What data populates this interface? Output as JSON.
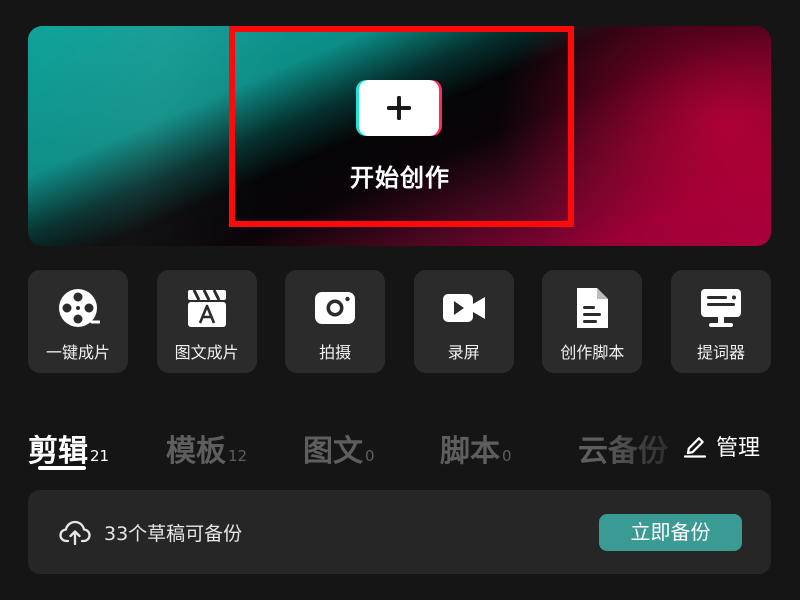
{
  "hero": {
    "create_label": "开始创作"
  },
  "tools": [
    {
      "label": "一键成片",
      "icon": "film-reel-icon"
    },
    {
      "label": "图文成片",
      "icon": "clapperboard-text-icon"
    },
    {
      "label": "拍摄",
      "icon": "camera-icon"
    },
    {
      "label": "录屏",
      "icon": "screen-record-icon"
    },
    {
      "label": "创作脚本",
      "icon": "script-document-icon"
    },
    {
      "label": "提词器",
      "icon": "teleprompter-icon"
    }
  ],
  "tabs": [
    {
      "label": "剪辑",
      "count": "21",
      "active": true
    },
    {
      "label": "模板",
      "count": "12",
      "active": false
    },
    {
      "label": "图文",
      "count": "0",
      "active": false
    },
    {
      "label": "脚本",
      "count": "0",
      "active": false
    },
    {
      "label": "云备份",
      "count": "",
      "active": false
    }
  ],
  "manage": {
    "label": "管理",
    "icon": "pencil-icon"
  },
  "backup": {
    "message": "33个草稿可备份",
    "button_label": "立即备份",
    "icon": "cloud-upload-icon"
  },
  "colors": {
    "background": "#151515",
    "card": "#2b2b2b",
    "accent_teal": "#3a9a94",
    "highlight_red": "#ff0a0a",
    "inactive_tab": "#5e5e5e"
  }
}
